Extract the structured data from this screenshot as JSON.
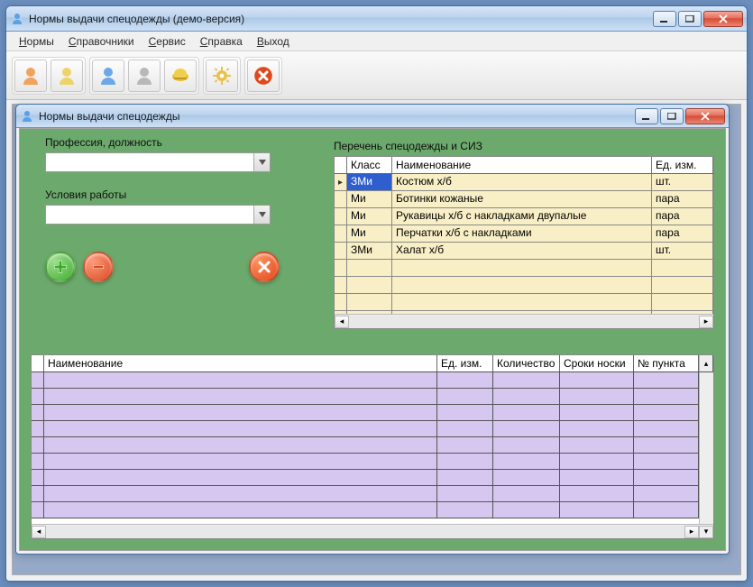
{
  "main_window": {
    "title": "Нормы выдачи спецодежды (демо-версия)"
  },
  "menu": {
    "items": [
      {
        "label": "Нормы",
        "underline": "Н"
      },
      {
        "label": "Справочники",
        "underline": "С"
      },
      {
        "label": "Сервис",
        "underline": "С"
      },
      {
        "label": "Справка",
        "underline": "С"
      },
      {
        "label": "Выход",
        "underline": "В"
      }
    ]
  },
  "toolbar": {
    "groups": [
      {
        "buttons": [
          "person-orange-icon",
          "person-yellow-icon"
        ]
      },
      {
        "buttons": [
          "person-blue-icon",
          "person-gray-icon",
          "helmet-icon"
        ]
      },
      {
        "buttons": [
          "gear-icon"
        ]
      },
      {
        "buttons": [
          "cancel-icon"
        ]
      }
    ]
  },
  "child_window": {
    "title": "Нормы выдачи спецодежды"
  },
  "form": {
    "profession_label": "Профессия, должность",
    "profession_value": "",
    "conditions_label": "Условия работы",
    "conditions_value": ""
  },
  "right_grid": {
    "title": "Перечень спецодежды и СИЗ",
    "headers": {
      "class": "Класс",
      "name": "Наименование",
      "uom": "Ед. изм."
    },
    "rows": [
      {
        "class": "ЗМи",
        "name": "Костюм х/б",
        "uom": "шт."
      },
      {
        "class": "Ми",
        "name": "Ботинки кожаные",
        "uom": "пара"
      },
      {
        "class": "Ми",
        "name": "Рукавицы х/б с накладками двупалые",
        "uom": "пара"
      },
      {
        "class": "Ми",
        "name": "Перчатки х/б с накладками",
        "uom": "пара"
      },
      {
        "class": "ЗМи",
        "name": "Халат х/б",
        "uom": "шт."
      }
    ],
    "selected_index": 0,
    "empty_rows_below": 4
  },
  "bottom_grid": {
    "headers": {
      "name": "Наименование",
      "uom": "Ед. изм.",
      "qty": "Количество",
      "term": "Сроки носки",
      "num": "№ пункта"
    },
    "row_count": 9
  },
  "colors": {
    "form_bg": "#6ca96c",
    "right_grid_row": "#f9efc6",
    "bottom_grid_row": "#d6c7f0",
    "selection": "#2f5fcf"
  }
}
